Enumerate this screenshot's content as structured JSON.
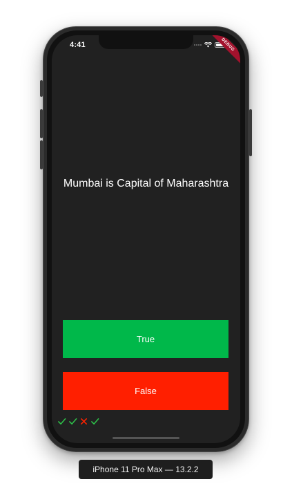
{
  "status_bar": {
    "time": "4:41",
    "debug_banner": "DEBUG"
  },
  "quiz": {
    "question": "Mumbai is Capital of Maharashtra",
    "true_label": "True",
    "false_label": "False",
    "score": [
      {
        "icon": "check-icon",
        "result": "correct"
      },
      {
        "icon": "check-icon",
        "result": "correct"
      },
      {
        "icon": "close-icon",
        "result": "wrong"
      },
      {
        "icon": "check-icon",
        "result": "correct"
      }
    ]
  },
  "device_label": "iPhone 11 Pro Max — 13.2.2",
  "colors": {
    "background": "#212121",
    "true_button": "#00b84a",
    "false_button": "#ff1f00",
    "correct": "#2ec24a",
    "wrong": "#ff2200"
  }
}
